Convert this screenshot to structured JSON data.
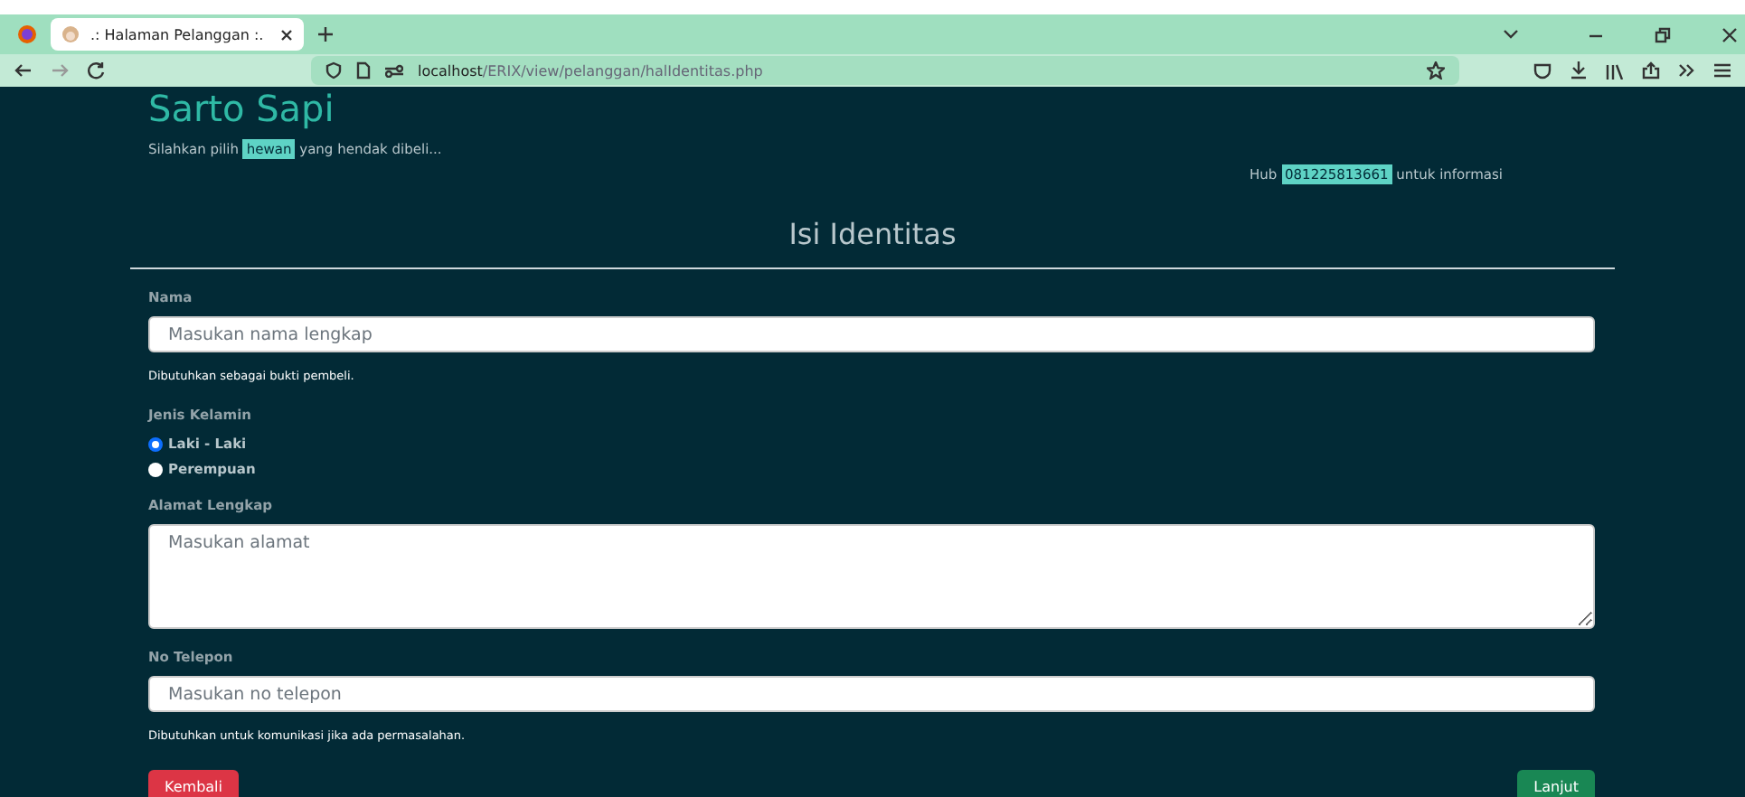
{
  "browser": {
    "tab_title": ".: Halaman Pelanggan :.",
    "url_host": "localhost",
    "url_path": "/ERIX/view/pelanggan/halIdentitas.php"
  },
  "header": {
    "brand": "Sarto Sapi",
    "tagline": {
      "before": "Silahkan pilih",
      "highlight": "hewan",
      "after": "yang hendak dibeli..."
    },
    "contact": {
      "before": "Hub",
      "highlight": "081225813661",
      "after": "untuk informasi"
    }
  },
  "form": {
    "title": "Isi Identitas",
    "fields": [
      {
        "kind": "text",
        "label": "Nama",
        "placeholder": "Masukan nama lengkap",
        "help": "Dibutuhkan sebagai bukti pembeli."
      },
      {
        "kind": "radio",
        "label": "Jenis Kelamin",
        "options": [
          {
            "label": "Laki - Laki",
            "selected": true
          },
          {
            "label": "Perempuan",
            "selected": false
          }
        ]
      },
      {
        "kind": "textarea",
        "label": "Alamat Lengkap",
        "placeholder": "Masukan alamat"
      },
      {
        "kind": "text",
        "label": "No Telepon",
        "placeholder": "Masukan no telepon",
        "help": "Dibutuhkan untuk komunikasi jika ada permasalahan."
      }
    ]
  },
  "buttons": [
    {
      "kind": "back",
      "label": "Kembali"
    },
    {
      "kind": "next",
      "label": "Lanjut"
    }
  ]
}
